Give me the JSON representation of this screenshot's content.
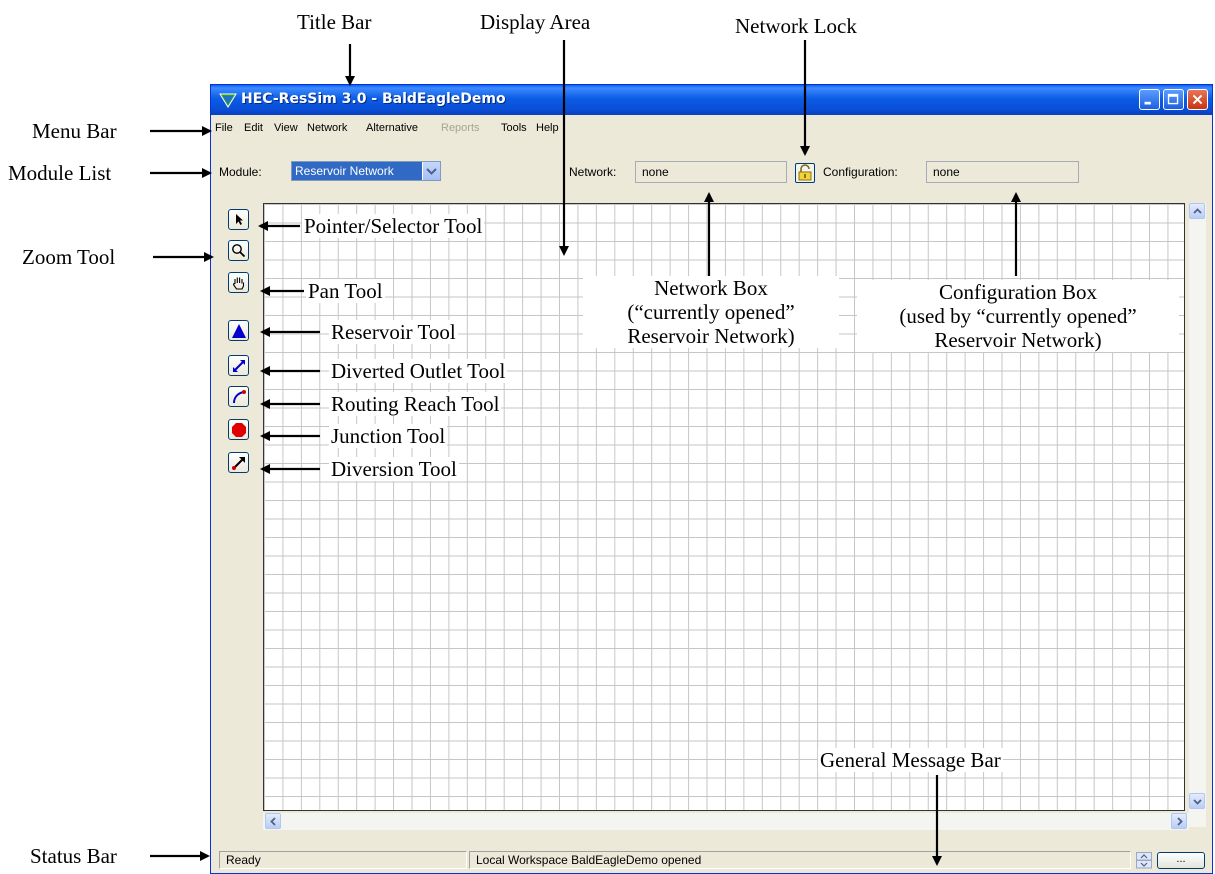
{
  "callouts": {
    "title_bar": "Title Bar",
    "display_area": "Display Area",
    "network_lock": "Network Lock",
    "menu_bar": "Menu Bar",
    "module_list": "Module List",
    "zoom_tool": "Zoom Tool",
    "pointer_tool": "Pointer/Selector Tool",
    "pan_tool": "Pan Tool",
    "reservoir_tool": "Reservoir Tool",
    "diverted_outlet_tool": "Diverted Outlet Tool",
    "routing_reach_tool": "Routing Reach Tool",
    "junction_tool": "Junction Tool",
    "diversion_tool": "Diversion Tool",
    "network_box": "Network Box\n(“currently opened”\nReservoir Network)",
    "configuration_box": "Configuration Box\n(used by “currently opened”\nReservoir Network)",
    "general_message_bar": "General Message Bar",
    "status_bar": "Status Bar"
  },
  "window": {
    "title": "HEC-ResSim 3.0  - BaldEagleDemo",
    "menu": [
      "File",
      "Edit",
      "View",
      "Network",
      "Alternative",
      "Reports",
      "Tools",
      "Help"
    ],
    "disabled_menu": "Reports",
    "module_label": "Module:",
    "module_value": "Reservoir Network",
    "network_label": "Network:",
    "network_value": "none",
    "configuration_label": "Configuration:",
    "configuration_value": "none",
    "status_text": "Ready",
    "message_text": "Local Workspace BaldEagleDemo opened",
    "dots_label": "..."
  },
  "colors": {
    "titlebar": "#0a5ce5",
    "selection": "#316ac5",
    "reservoir": "#0000cc",
    "junction": "#e00000"
  }
}
